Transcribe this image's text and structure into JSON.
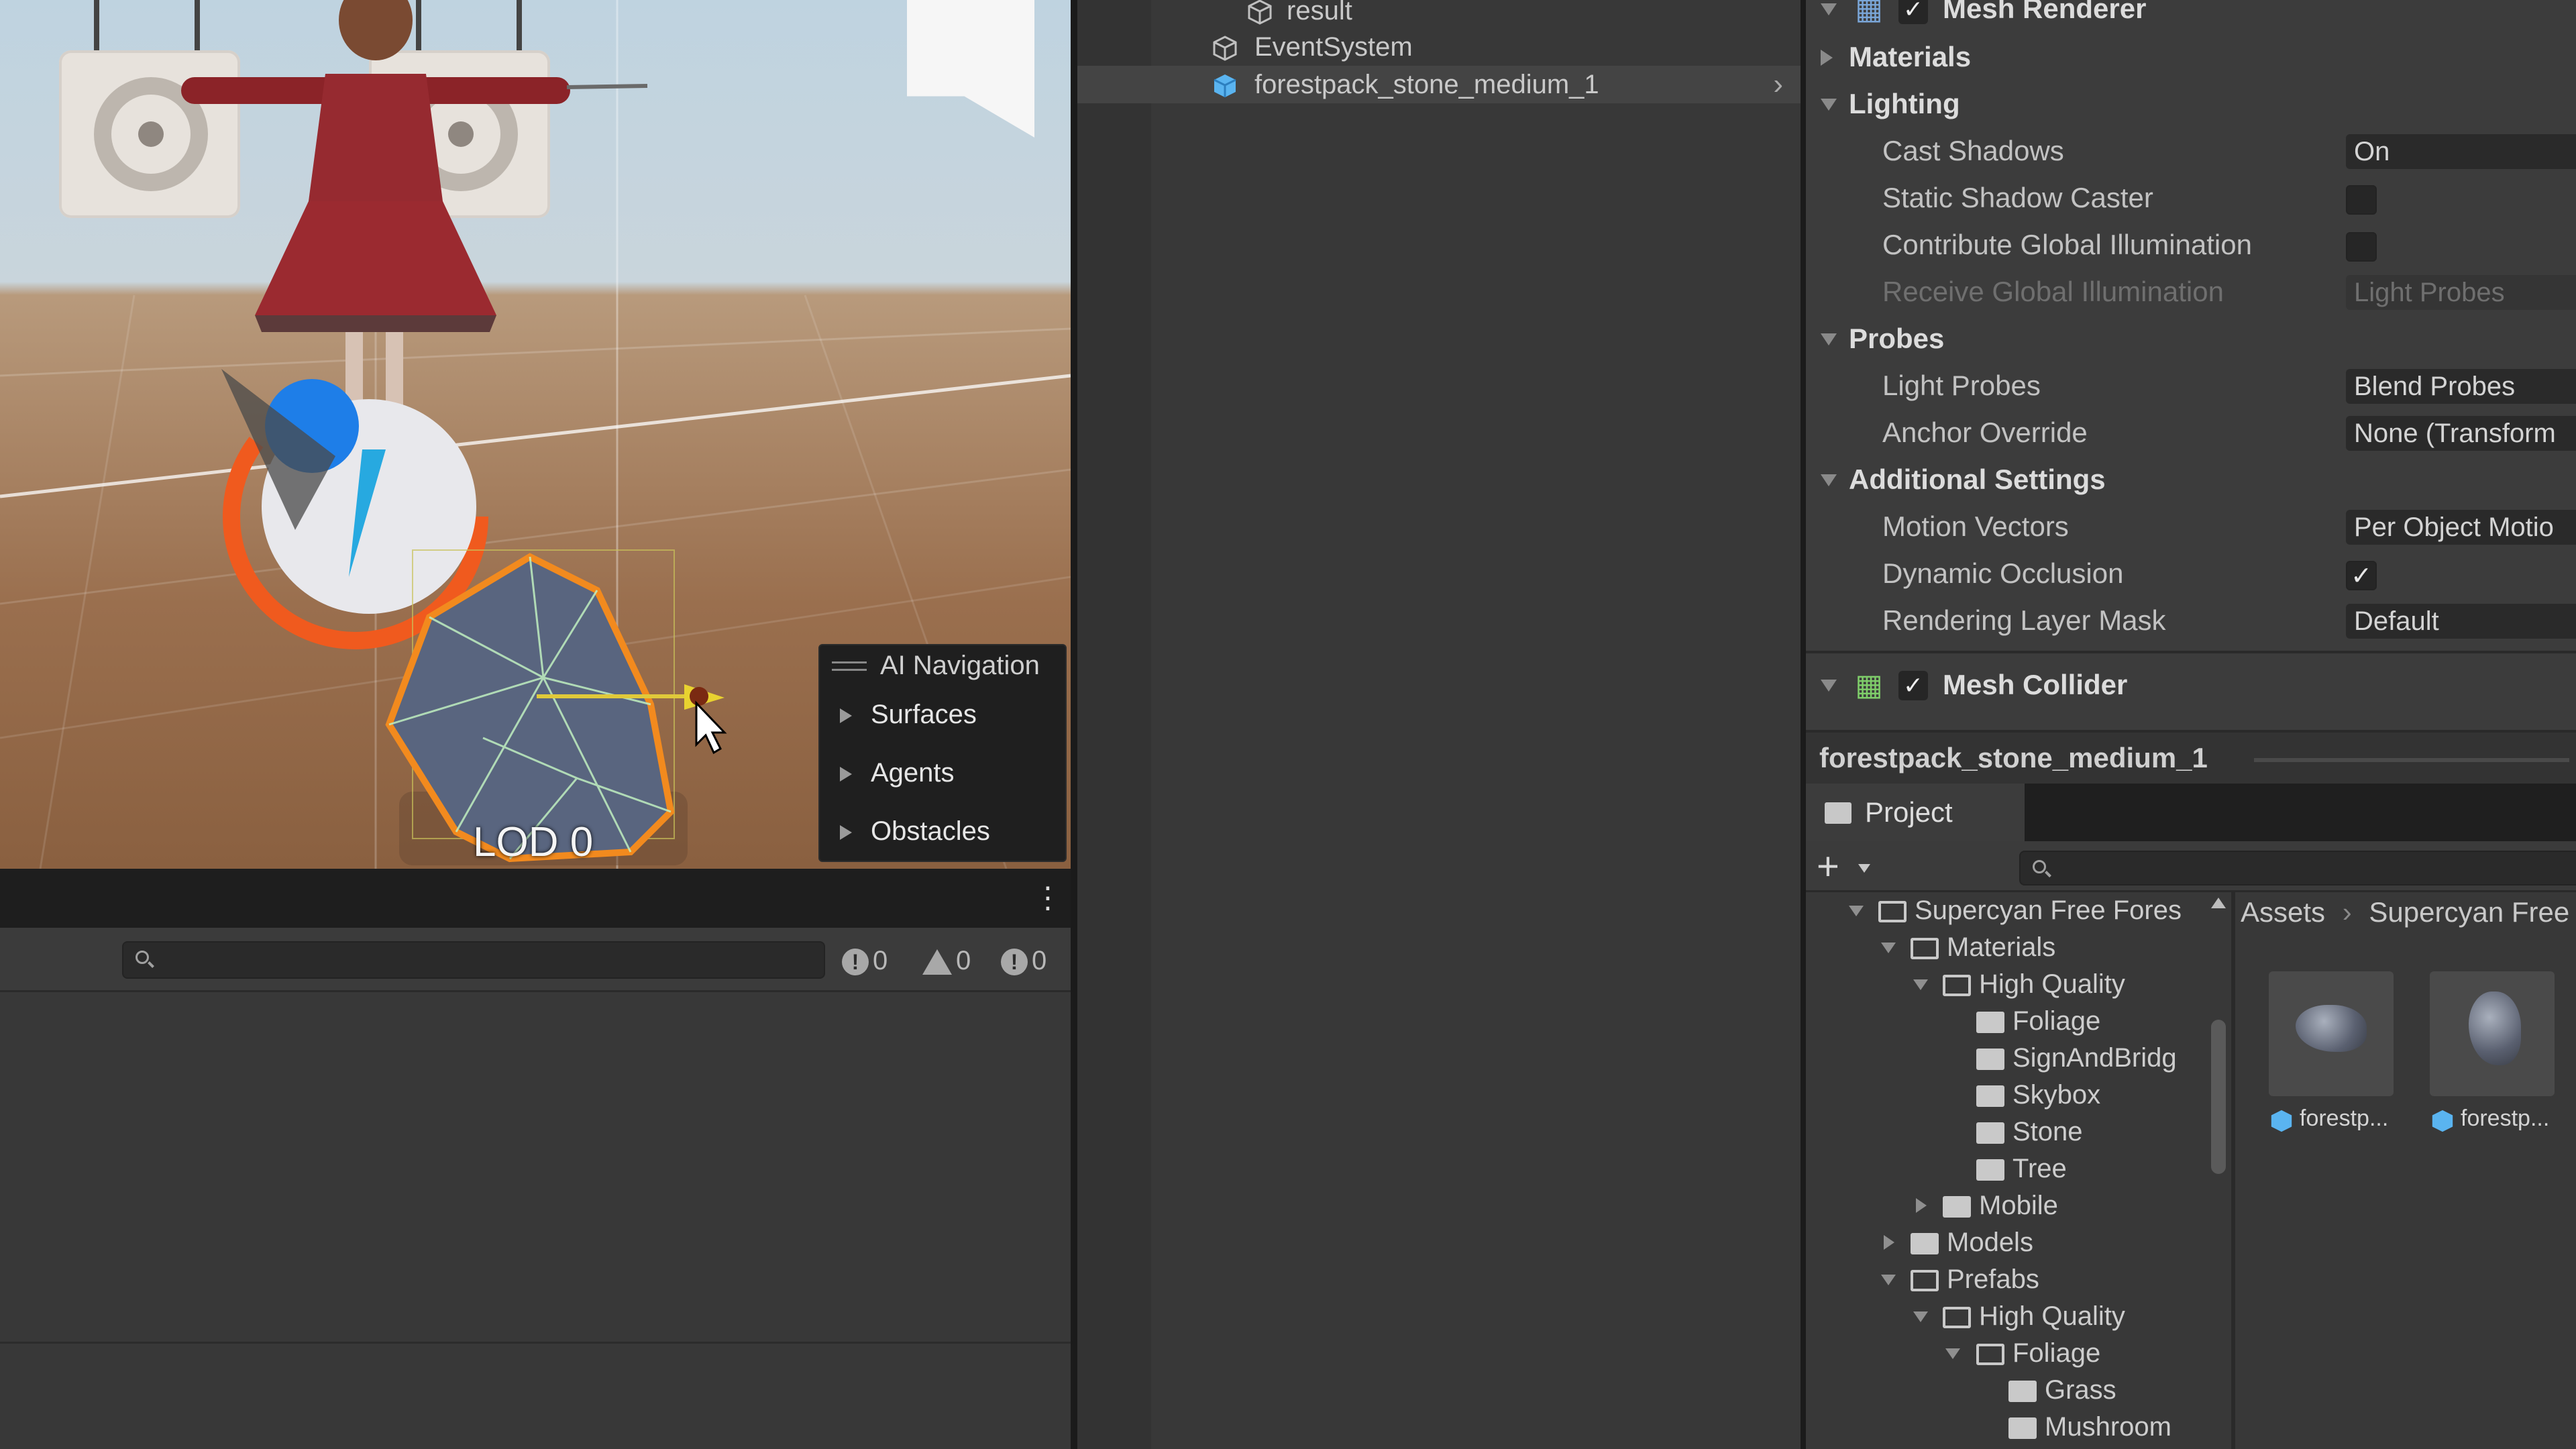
{
  "scene": {
    "lod_label": "LOD 0",
    "ai_navigation": {
      "title": "AI Navigation",
      "items": [
        "Surfaces",
        "Agents",
        "Obstacles"
      ]
    }
  },
  "console": {
    "search_placeholder": "",
    "counts": {
      "messages": "0",
      "warnings": "0",
      "errors": "0"
    }
  },
  "hierarchy": {
    "rows": [
      {
        "label": "result"
      },
      {
        "label": "EventSystem"
      },
      {
        "label": "forestpack_stone_medium_1",
        "selected": true
      }
    ]
  },
  "inspector": {
    "mesh_renderer": {
      "title": "Mesh Renderer"
    },
    "materials": "Materials",
    "lighting": {
      "title": "Lighting",
      "cast_shadows_label": "Cast Shadows",
      "cast_shadows_value": "On",
      "static_shadow_caster_label": "Static Shadow Caster",
      "contribute_gi_label": "Contribute Global Illumination",
      "receive_gi_label": "Receive Global Illumination",
      "receive_gi_value": "Light Probes"
    },
    "probes": {
      "title": "Probes",
      "light_probes_label": "Light Probes",
      "light_probes_value": "Blend Probes",
      "anchor_override_label": "Anchor Override",
      "anchor_override_value": "None (Transform"
    },
    "additional": {
      "title": "Additional Settings",
      "motion_vectors_label": "Motion Vectors",
      "motion_vectors_value": "Per Object Motio",
      "dynamic_occlusion_label": "Dynamic Occlusion",
      "rendering_layer_label": "Rendering Layer Mask",
      "rendering_layer_value": "Default"
    },
    "mesh_collider": {
      "title": "Mesh Collider"
    }
  },
  "preview_title": "forestpack_stone_medium_1",
  "project": {
    "tab": "Project",
    "breadcrumb": [
      "Assets",
      "Supercyan Free"
    ],
    "tree": [
      {
        "label": "Supercyan Free Fores",
        "depth": 0,
        "open": true
      },
      {
        "label": "Materials",
        "depth": 1,
        "open": true
      },
      {
        "label": "High Quality",
        "depth": 2,
        "open": true
      },
      {
        "label": "Foliage",
        "depth": 3
      },
      {
        "label": "SignAndBridg",
        "depth": 3
      },
      {
        "label": "Skybox",
        "depth": 3
      },
      {
        "label": "Stone",
        "depth": 3
      },
      {
        "label": "Tree",
        "depth": 3
      },
      {
        "label": "Mobile",
        "depth": 2,
        "closed": true
      },
      {
        "label": "Models",
        "depth": 1,
        "closed": true
      },
      {
        "label": "Prefabs",
        "depth": 1,
        "open": true
      },
      {
        "label": "High Quality",
        "depth": 2,
        "open": true
      },
      {
        "label": "Foliage",
        "depth": 3,
        "open": true
      },
      {
        "label": "Grass",
        "depth": 4
      },
      {
        "label": "Mushroom",
        "depth": 4
      }
    ],
    "assets": [
      {
        "label": "forestp..."
      },
      {
        "label": "forestp..."
      }
    ]
  },
  "colors": {
    "selection": "#f28a1e",
    "accent_cube": "#5ab4f0",
    "check_green": "#7fce6a"
  }
}
